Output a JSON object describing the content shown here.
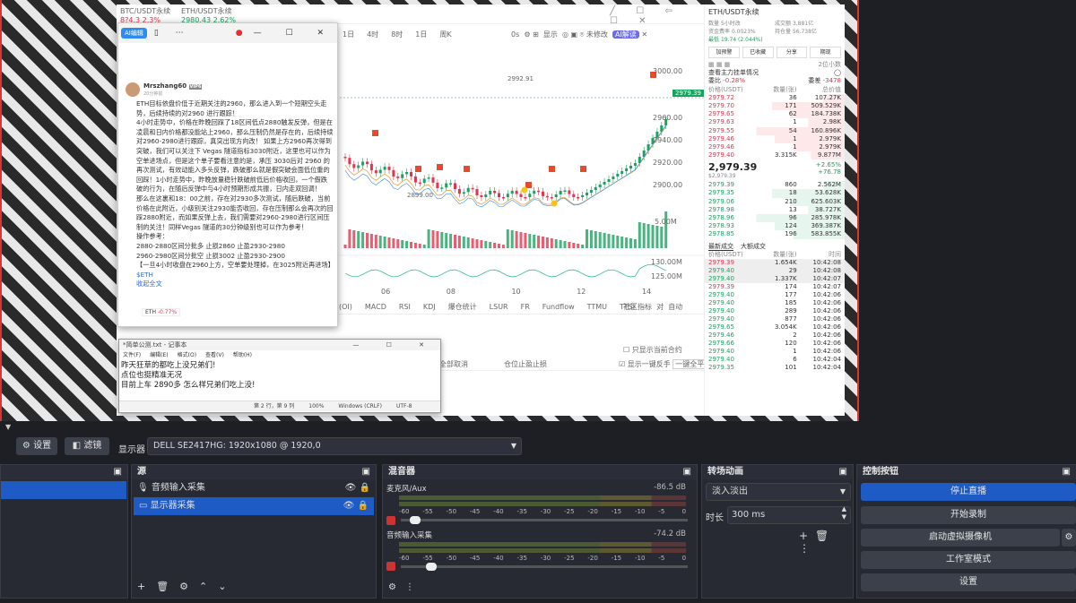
{
  "trading": {
    "top_tickers": [
      {
        "name": "BTC/USDT永续",
        "value": "8?4.3 2.3%"
      },
      {
        "name": "ETH/USDT永续",
        "value": "2980.43 2.62%"
      }
    ],
    "timeframes": [
      "1日",
      "4时",
      "8时",
      "1日",
      "周K"
    ],
    "toolbar_right": [
      "0s",
      "显示",
      "未修改",
      "AI解读"
    ],
    "price_levels": [
      "3000.00",
      "2979.39",
      "2960.00",
      "2940.00",
      "2920.00",
      "2900.00"
    ],
    "high_label": "2992.91",
    "low_label": "2899.00",
    "volume_labels": [
      "5.00M",
      "130.00M",
      "125.00M"
    ],
    "x_ticks": [
      "06",
      "08",
      "10",
      "12",
      "14"
    ],
    "indicators": [
      "(OI)",
      "MACD",
      "RSI",
      "KDJ",
      "爆仓统计",
      "LSUR",
      "FR",
      "Fundflow",
      "TTMU",
      "TTSI"
    ],
    "indicator_right": [
      "社区指标",
      "对",
      "自动"
    ],
    "bottom_opts": [
      "只显示当前合约",
      "显示一键反手",
      "一键全平"
    ],
    "bottom_cols": [
      "全部取消",
      "仓位止盈止损"
    ]
  },
  "book": {
    "symbol": "ETH/USDT永续",
    "stats": [
      {
        "k": "数量",
        "v": "5小时改"
      },
      {
        "k": "成交额",
        "v": "3,881亿"
      },
      {
        "k": "资金费率",
        "v": "0.0023%"
      },
      {
        "k": "持仓量",
        "v": "56.738亿"
      },
      {
        "k": "最低",
        "v": "19.74 (2.044%)"
      }
    ],
    "tabs": [
      "加预警",
      "已收藏",
      "分享",
      "期现"
    ],
    "depth": "2位小数",
    "mainline": "查看主力挂单情况",
    "ratio": [
      "委比",
      "-0.28%",
      "委差",
      "-3478"
    ],
    "headers": [
      "价格(USDT)",
      "数量(张)",
      "总价值"
    ],
    "asks": [
      [
        "2979.72",
        "36",
        "107.27K"
      ],
      [
        "2979.70",
        "171",
        "509.529K"
      ],
      [
        "2979.65",
        "62",
        "184.738K"
      ],
      [
        "2979.63",
        "1",
        "2.98K"
      ],
      [
        "2979.55",
        "54",
        "160.896K"
      ],
      [
        "2979.46",
        "1",
        "2.979K"
      ],
      [
        "2979.46",
        "1",
        "2.979K"
      ],
      [
        "2979.40",
        "3.315K",
        "9.877M"
      ]
    ],
    "last_price": "2,979.39",
    "last_sub": "$2,979.39",
    "change_pct": "+2.65%",
    "change_abs": "+76.78",
    "bids": [
      [
        "2979.39",
        "860",
        "2.562M"
      ],
      [
        "2979.35",
        "18",
        "53.628K"
      ],
      [
        "2979.06",
        "210",
        "625.603K"
      ],
      [
        "2978.98",
        "13",
        "38.727K"
      ],
      [
        "2978.96",
        "96",
        "285.978K"
      ],
      [
        "2978.93",
        "124",
        "369.387K"
      ],
      [
        "2978.85",
        "196",
        "583.855K"
      ]
    ],
    "trade_tabs": [
      "最新成交",
      "大额成交"
    ],
    "trade_headers": [
      "价格(USDT)",
      "数量(张)",
      "时间"
    ],
    "trades": [
      [
        "2979.39",
        "1.654K",
        "10:42:08"
      ],
      [
        "2979.40",
        "29",
        "10:42:08"
      ],
      [
        "2979.40",
        "1.337K",
        "10:42:07"
      ],
      [
        "2979.39",
        "174",
        "10:42:07"
      ],
      [
        "2979.40",
        "177",
        "10:42:06"
      ],
      [
        "2979.40",
        "185",
        "10:42:06"
      ],
      [
        "2979.40",
        "289",
        "10:42:06"
      ],
      [
        "2979.40",
        "877",
        "10:42:06"
      ],
      [
        "2979.65",
        "3.054K",
        "10:42:06"
      ],
      [
        "2979.46",
        "2",
        "10:42:06"
      ],
      [
        "2979.66",
        "120",
        "10:42:06"
      ],
      [
        "2979.40",
        "1",
        "10:42:06"
      ],
      [
        "2979.40",
        "6",
        "10:42:04"
      ],
      [
        "2979.35",
        "101",
        "10:42:04"
      ]
    ]
  },
  "floatwin": {
    "ai_btn": "AI编辑",
    "user": "Mrszhang60",
    "user_badge": "VIP6",
    "time": "20分钟前",
    "paragraphs": [
      "ETH目标依盘价低于近期关注的2960，那么进入到一个短期空头走势，后续持续的对2960 进行跟踪！",
      "4小时走势中，价格在昨晚回踩了18区间低点2880触发反弹，但是在凌晨和日内价格都没能站上2960，那么压制仍然是存在的，后续持续对2960-2980进行跟踪，真突出现方向改！ 如果上方2960再次得到突破，我们可以关注下 Vegas 隧道指标3030附近，这里也可以作为空单进场点，但是这个单子要看注意的是，承压 3030后对 2960 的再次测试，有效动能入多头反弹，跌破那么就是假突破会面低位重的回踩！1小时走势中，昨晚放量稳针跌破前低后价格收回，一个假跌破的行为，在随后反弹中与4小时预期形成共振，日内走双回调！",
      "那么在这裏和18：00之前，存在对2930多次测试，随后跌破，当前价格在此附近，小级别关注2930能否收回，存在压制那么会再次的回踩2880附近，而如果反弹上去，我们需要对2960-2980进行区间压制的关注！同样Vegas 隧道的30分钟级别也可以作为参考！",
      "操作参考：",
      "2880-2880区间分批多 止损2860 止盈2930-2980",
      "2960-2980区间分批空 止损3002 止盈2930-2900",
      "【一旦4小时收盘在2960上方，空单要处理掉，在3025附近再进场】"
    ],
    "tag": "$ETH",
    "collapse": "收起全文",
    "footer_sym": "ETH",
    "footer_chg": "-0.77%"
  },
  "notepad": {
    "title": "*简单公测.txt - 记事本",
    "menus": [
      "文件(F)",
      "编辑(E)",
      "格式(O)",
      "查看(V)",
      "帮助(H)"
    ],
    "lines": [
      "昨天狂草的都吃上没兄弟们!",
      "点位也挺精准无况",
      "目前上车 2890多 怎么样兄弟们吃上没!"
    ],
    "status": [
      "第 2 行，第 9 列",
      "100%",
      "Windows (CRLF)",
      "UTF-8"
    ]
  },
  "obs": {
    "settings": "设置",
    "filters": "滤镜",
    "display_label": "显示器",
    "display_value": "DELL SE2417HG: 1920x1080 @ 1920,0",
    "sources_title": "源",
    "sources": [
      {
        "name": "音频输入采集",
        "icon": "mic-icon"
      },
      {
        "name": "显示器采集",
        "icon": "monitor-icon"
      }
    ],
    "mixer_title": "混音器",
    "mixer": [
      {
        "name": "麦克风/Aux",
        "db": "-86.5 dB"
      },
      {
        "name": "音频输入采集",
        "db": "-74.2 dB"
      }
    ],
    "scale": [
      "-60",
      "-55",
      "-50",
      "-45",
      "-40",
      "-35",
      "-30",
      "-25",
      "-20",
      "-15",
      "-10",
      "-5",
      "0"
    ],
    "transition_title": "转场动画",
    "transition": "淡入淡出",
    "duration_label": "时长",
    "duration": "300 ms",
    "controls_title": "控制按钮",
    "controls": [
      "停止直播",
      "开始录制",
      "启动虚拟摄像机",
      "工作室模式",
      "设置"
    ],
    "accent": "#1f5bc5"
  }
}
